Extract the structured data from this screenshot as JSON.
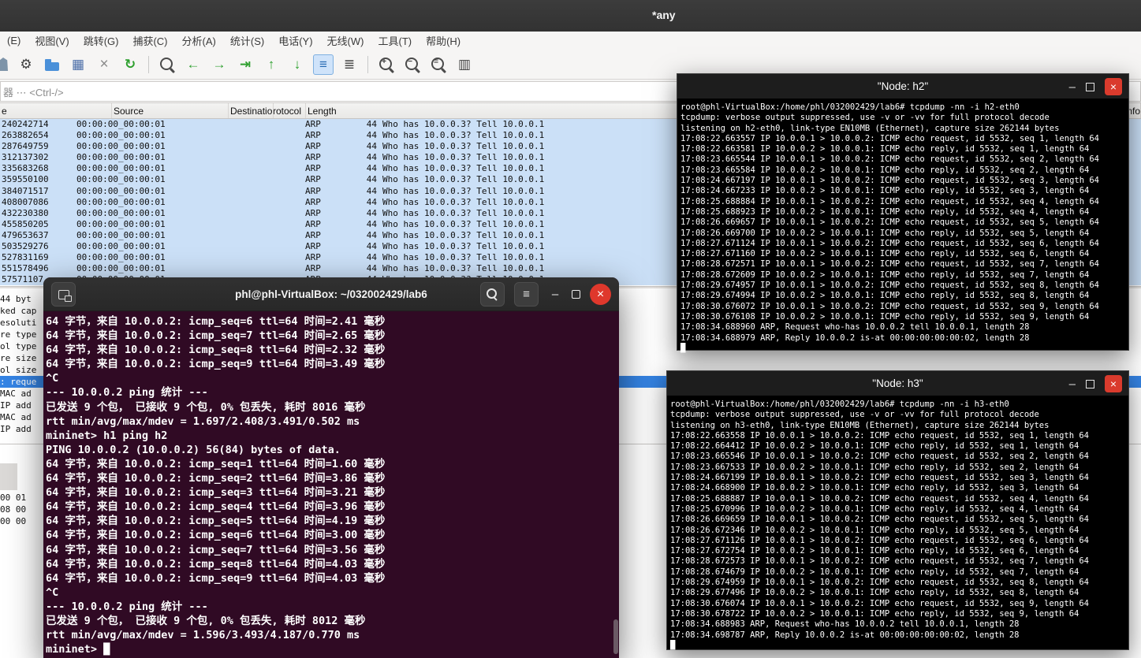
{
  "icons": {
    "minimize_glyph": "–",
    "close_glyph": "×",
    "hamburger_glyph": "≡"
  },
  "wireshark": {
    "title": "*any",
    "menu_items": [
      "(E)",
      "视图(V)",
      "跳转(G)",
      "捕获(C)",
      "分析(A)",
      "统计(S)",
      "电话(Y)",
      "无线(W)",
      "工具(T)",
      "帮助(H)"
    ],
    "toolbar_icons": [
      {
        "name": "start-capture-icon",
        "glyph": "",
        "cls": "fin"
      },
      {
        "name": "capture-options-icon",
        "glyph": "⚙",
        "cls": "dark"
      },
      {
        "name": "open-capture-icon",
        "glyph": "",
        "cls": "folder"
      },
      {
        "name": "save-capture-icon",
        "glyph": "▦",
        "cls": "blue"
      },
      {
        "name": "close-capture-icon",
        "glyph": "×",
        "cls": "gray"
      },
      {
        "name": "reload-icon",
        "glyph": "↻",
        "cls": "green"
      },
      {
        "name": "toolbar-separator",
        "glyph": "",
        "cls": "separator"
      },
      {
        "name": "find-packet-icon",
        "glyph": "",
        "cls": "magnifier"
      },
      {
        "name": "go-back-icon",
        "glyph": "←",
        "cls": "green"
      },
      {
        "name": "go-forward-icon",
        "glyph": "→",
        "cls": "green"
      },
      {
        "name": "go-to-packet-icon",
        "glyph": "⇥",
        "cls": "green"
      },
      {
        "name": "go-first-packet-icon",
        "glyph": "↑",
        "cls": "green"
      },
      {
        "name": "go-last-packet-icon",
        "glyph": "↓",
        "cls": "green"
      },
      {
        "name": "autoscroll-icon",
        "glyph": "≡",
        "cls": "pressed"
      },
      {
        "name": "colorize-icon",
        "glyph": "≣",
        "cls": "dark"
      },
      {
        "name": "toolbar-separator",
        "glyph": "",
        "cls": "separator"
      },
      {
        "name": "zoom-in-icon",
        "glyph": "+",
        "cls": "magnifier"
      },
      {
        "name": "zoom-out-icon",
        "glyph": "−",
        "cls": "magnifier"
      },
      {
        "name": "zoom-reset-icon",
        "glyph": "=",
        "cls": "magnifier"
      },
      {
        "name": "resize-columns-icon",
        "glyph": "▥",
        "cls": "dark"
      }
    ],
    "filter_placeholder": "器 ⋯ <Ctrl-/>",
    "columns": [
      "e",
      "Source",
      "Destination",
      "Protocol",
      "Length",
      "Info"
    ],
    "packets": [
      {
        "time": "240242714",
        "source": "00:00:00_00:00:01",
        "destination": "",
        "protocol": "ARP",
        "length": "44",
        "info": "Who has 10.0.0.3? Tell 10.0.0.1"
      },
      {
        "time": "263882654",
        "source": "00:00:00_00:00:01",
        "destination": "",
        "protocol": "ARP",
        "length": "44",
        "info": "Who has 10.0.0.3? Tell 10.0.0.1"
      },
      {
        "time": "287649759",
        "source": "00:00:00_00:00:01",
        "destination": "",
        "protocol": "ARP",
        "length": "44",
        "info": "Who has 10.0.0.3? Tell 10.0.0.1"
      },
      {
        "time": "312137302",
        "source": "00:00:00_00:00:01",
        "destination": "",
        "protocol": "ARP",
        "length": "44",
        "info": "Who has 10.0.0.3? Tell 10.0.0.1"
      },
      {
        "time": "335683268",
        "source": "00:00:00_00:00:01",
        "destination": "",
        "protocol": "ARP",
        "length": "44",
        "info": "Who has 10.0.0.3? Tell 10.0.0.1"
      },
      {
        "time": "359550100",
        "source": "00:00:00_00:00:01",
        "destination": "",
        "protocol": "ARP",
        "length": "44",
        "info": "Who has 10.0.0.3? Tell 10.0.0.1"
      },
      {
        "time": "384071517",
        "source": "00:00:00_00:00:01",
        "destination": "",
        "protocol": "ARP",
        "length": "44",
        "info": "Who has 10.0.0.3? Tell 10.0.0.1"
      },
      {
        "time": "408007086",
        "source": "00:00:00_00:00:01",
        "destination": "",
        "protocol": "ARP",
        "length": "44",
        "info": "Who has 10.0.0.3? Tell 10.0.0.1"
      },
      {
        "time": "432230380",
        "source": "00:00:00_00:00:01",
        "destination": "",
        "protocol": "ARP",
        "length": "44",
        "info": "Who has 10.0.0.3? Tell 10.0.0.1"
      },
      {
        "time": "455850205",
        "source": "00:00:00_00:00:01",
        "destination": "",
        "protocol": "ARP",
        "length": "44",
        "info": "Who has 10.0.0.3? Tell 10.0.0.1"
      },
      {
        "time": "479653637",
        "source": "00:00:00_00:00:01",
        "destination": "",
        "protocol": "ARP",
        "length": "44",
        "info": "Who has 10.0.0.3? Tell 10.0.0.1"
      },
      {
        "time": "503529276",
        "source": "00:00:00_00:00:01",
        "destination": "",
        "protocol": "ARP",
        "length": "44",
        "info": "Who has 10.0.0.3? Tell 10.0.0.1"
      },
      {
        "time": "527831169",
        "source": "00:00:00_00:00:01",
        "destination": "",
        "protocol": "ARP",
        "length": "44",
        "info": "Who has 10.0.0.3? Tell 10.0.0.1"
      },
      {
        "time": "551578496",
        "source": "00:00:00_00:00:01",
        "destination": "",
        "protocol": "ARP",
        "length": "44",
        "info": "Who has 10.0.0.3? Tell 10.0.0.1"
      },
      {
        "time": "57571107",
        "source": "00:00:00_00:00:01",
        "destination": "",
        "protocol": "ARP",
        "length": "44",
        "info": "Who has 10.0.0.3? Tell 10.0.0.1"
      }
    ],
    "detail_rows": [
      {
        "text": "44 byt",
        "cls": ""
      },
      {
        "text": "ked cap",
        "cls": ""
      },
      {
        "text": "esoluti",
        "cls": ""
      },
      {
        "text": "re type",
        "cls": ""
      },
      {
        "text": "ol type",
        "cls": ""
      },
      {
        "text": "re size",
        "cls": ""
      },
      {
        "text": "ol size",
        "cls": ""
      },
      {
        "text": ": reque",
        "cls": "selected"
      },
      {
        "text": "MAC ad",
        "cls": ""
      },
      {
        "text": "IP add",
        "cls": ""
      },
      {
        "text": "MAC ad",
        "cls": ""
      },
      {
        "text": "IP add",
        "cls": ""
      }
    ],
    "hex_lines": [
      "00 01",
      "08 00",
      "00 00"
    ]
  },
  "terminal": {
    "title": "phl@phl-VirtualBox: ~/032002429/lab6",
    "lines": [
      "64 字节，来自 10.0.0.2: icmp_seq=6 ttl=64 时间=2.41 毫秒",
      "64 字节，来自 10.0.0.2: icmp_seq=7 ttl=64 时间=2.65 毫秒",
      "64 字节，来自 10.0.0.2: icmp_seq=8 ttl=64 时间=2.32 毫秒",
      "64 字节，来自 10.0.0.2: icmp_seq=9 ttl=64 时间=3.49 毫秒",
      "^C",
      "--- 10.0.0.2 ping 统计 ---",
      "已发送 9 个包， 已接收 9 个包, 0% 包丢失, 耗时 8016 毫秒",
      "rtt min/avg/max/mdev = 1.697/2.408/3.491/0.502 ms",
      "mininet> h1 ping h2",
      "PING 10.0.0.2 (10.0.0.2) 56(84) bytes of data.",
      "64 字节，来自 10.0.0.2: icmp_seq=1 ttl=64 时间=1.60 毫秒",
      "64 字节，来自 10.0.0.2: icmp_seq=2 ttl=64 时间=3.86 毫秒",
      "64 字节，来自 10.0.0.2: icmp_seq=3 ttl=64 时间=3.21 毫秒",
      "64 字节，来自 10.0.0.2: icmp_seq=4 ttl=64 时间=3.96 毫秒",
      "64 字节，来自 10.0.0.2: icmp_seq=5 ttl=64 时间=4.19 毫秒",
      "64 字节，来自 10.0.0.2: icmp_seq=6 ttl=64 时间=3.00 毫秒",
      "64 字节，来自 10.0.0.2: icmp_seq=7 ttl=64 时间=3.56 毫秒",
      "64 字节，来自 10.0.0.2: icmp_seq=8 ttl=64 时间=4.03 毫秒",
      "64 字节，来自 10.0.0.2: icmp_seq=9 ttl=64 时间=4.03 毫秒",
      "^C",
      "--- 10.0.0.2 ping 统计 ---",
      "已发送 9 个包， 已接收 9 个包, 0% 包丢失, 耗时 8012 毫秒",
      "rtt min/avg/max/mdev = 1.596/3.493/4.187/0.770 ms",
      "mininet> █"
    ]
  },
  "node_h2": {
    "title": "\"Node: h2\"",
    "lines": [
      "root@phl-VirtualBox:/home/phl/032002429/lab6# tcpdump -nn -i h2-eth0",
      "tcpdump: verbose output suppressed, use -v or -vv for full protocol decode",
      "listening on h2-eth0, link-type EN10MB (Ethernet), capture size 262144 bytes",
      "17:08:22.663557 IP 10.0.0.1 > 10.0.0.2: ICMP echo request, id 5532, seq 1, length 64",
      "17:08:22.663581 IP 10.0.0.2 > 10.0.0.1: ICMP echo reply, id 5532, seq 1, length 64",
      "17:08:23.665544 IP 10.0.0.1 > 10.0.0.2: ICMP echo request, id 5532, seq 2, length 64",
      "17:08:23.665584 IP 10.0.0.2 > 10.0.0.1: ICMP echo reply, id 5532, seq 2, length 64",
      "17:08:24.667197 IP 10.0.0.1 > 10.0.0.2: ICMP echo request, id 5532, seq 3, length 64",
      "17:08:24.667233 IP 10.0.0.2 > 10.0.0.1: ICMP echo reply, id 5532, seq 3, length 64",
      "17:08:25.688884 IP 10.0.0.1 > 10.0.0.2: ICMP echo request, id 5532, seq 4, length 64",
      "17:08:25.688923 IP 10.0.0.2 > 10.0.0.1: ICMP echo reply, id 5532, seq 4, length 64",
      "17:08:26.669657 IP 10.0.0.1 > 10.0.0.2: ICMP echo request, id 5532, seq 5, length 64",
      "17:08:26.669700 IP 10.0.0.2 > 10.0.0.1: ICMP echo reply, id 5532, seq 5, length 64",
      "17:08:27.671124 IP 10.0.0.1 > 10.0.0.2: ICMP echo request, id 5532, seq 6, length 64",
      "17:08:27.671160 IP 10.0.0.2 > 10.0.0.1: ICMP echo reply, id 5532, seq 6, length 64",
      "17:08:28.672571 IP 10.0.0.1 > 10.0.0.2: ICMP echo request, id 5532, seq 7, length 64",
      "17:08:28.672609 IP 10.0.0.2 > 10.0.0.1: ICMP echo reply, id 5532, seq 7, length 64",
      "17:08:29.674957 IP 10.0.0.1 > 10.0.0.2: ICMP echo request, id 5532, seq 8, length 64",
      "17:08:29.674994 IP 10.0.0.2 > 10.0.0.1: ICMP echo reply, id 5532, seq 8, length 64",
      "17:08:30.676072 IP 10.0.0.1 > 10.0.0.2: ICMP echo request, id 5532, seq 9, length 64",
      "17:08:30.676108 IP 10.0.0.2 > 10.0.0.1: ICMP echo reply, id 5532, seq 9, length 64",
      "17:08:34.688960 ARP, Request who-has 10.0.0.2 tell 10.0.0.1, length 28",
      "17:08:34.688979 ARP, Reply 10.0.0.2 is-at 00:00:00:00:00:02, length 28",
      "█"
    ]
  },
  "node_h3": {
    "title": "\"Node: h3\"",
    "lines": [
      "root@phl-VirtualBox:/home/phl/032002429/lab6# tcpdump -nn -i h3-eth0",
      "tcpdump: verbose output suppressed, use -v or -vv for full protocol decode",
      "listening on h3-eth0, link-type EN10MB (Ethernet), capture size 262144 bytes",
      "17:08:22.663558 IP 10.0.0.1 > 10.0.0.2: ICMP echo request, id 5532, seq 1, length 64",
      "17:08:22.664412 IP 10.0.0.2 > 10.0.0.1: ICMP echo reply, id 5532, seq 1, length 64",
      "17:08:23.665546 IP 10.0.0.1 > 10.0.0.2: ICMP echo request, id 5532, seq 2, length 64",
      "17:08:23.667533 IP 10.0.0.2 > 10.0.0.1: ICMP echo reply, id 5532, seq 2, length 64",
      "17:08:24.667199 IP 10.0.0.1 > 10.0.0.2: ICMP echo request, id 5532, seq 3, length 64",
      "17:08:24.668900 IP 10.0.0.2 > 10.0.0.1: ICMP echo reply, id 5532, seq 3, length 64",
      "17:08:25.688887 IP 10.0.0.1 > 10.0.0.2: ICMP echo request, id 5532, seq 4, length 64",
      "17:08:25.670996 IP 10.0.0.2 > 10.0.0.1: ICMP echo reply, id 5532, seq 4, length 64",
      "17:08:26.669659 IP 10.0.0.1 > 10.0.0.2: ICMP echo request, id 5532, seq 5, length 64",
      "17:08:26.672346 IP 10.0.0.2 > 10.0.0.1: ICMP echo reply, id 5532, seq 5, length 64",
      "17:08:27.671126 IP 10.0.0.1 > 10.0.0.2: ICMP echo request, id 5532, seq 6, length 64",
      "17:08:27.672754 IP 10.0.0.2 > 10.0.0.1: ICMP echo reply, id 5532, seq 6, length 64",
      "17:08:28.672573 IP 10.0.0.1 > 10.0.0.2: ICMP echo request, id 5532, seq 7, length 64",
      "17:08:28.674679 IP 10.0.0.2 > 10.0.0.1: ICMP echo reply, id 5532, seq 7, length 64",
      "17:08:29.674959 IP 10.0.0.1 > 10.0.0.2: ICMP echo request, id 5532, seq 8, length 64",
      "17:08:29.677496 IP 10.0.0.2 > 10.0.0.1: ICMP echo reply, id 5532, seq 8, length 64",
      "17:08:30.676074 IP 10.0.0.1 > 10.0.0.2: ICMP echo request, id 5532, seq 9, length 64",
      "17:08:30.678722 IP 10.0.0.2 > 10.0.0.1: ICMP echo reply, id 5532, seq 9, length 64",
      "17:08:34.688983 ARP, Request who-has 10.0.0.2 tell 10.0.0.1, length 28",
      "17:08:34.698787 ARP, Reply 10.0.0.2 is-at 00:00:00:00:00:02, length 28",
      "█"
    ]
  }
}
